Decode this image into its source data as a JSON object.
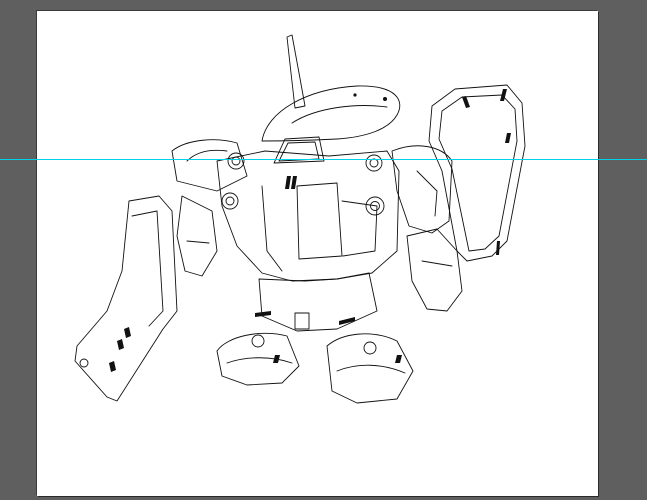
{
  "app": {
    "name": "vector-editor",
    "view": "artboard"
  },
  "artboard": {
    "background": "#ffffff",
    "frame_color": "#5f5f5f"
  },
  "guide": {
    "orientation": "horizontal",
    "color": "#00d0e8"
  },
  "artwork": {
    "subject": "robot-line-art-icon"
  }
}
